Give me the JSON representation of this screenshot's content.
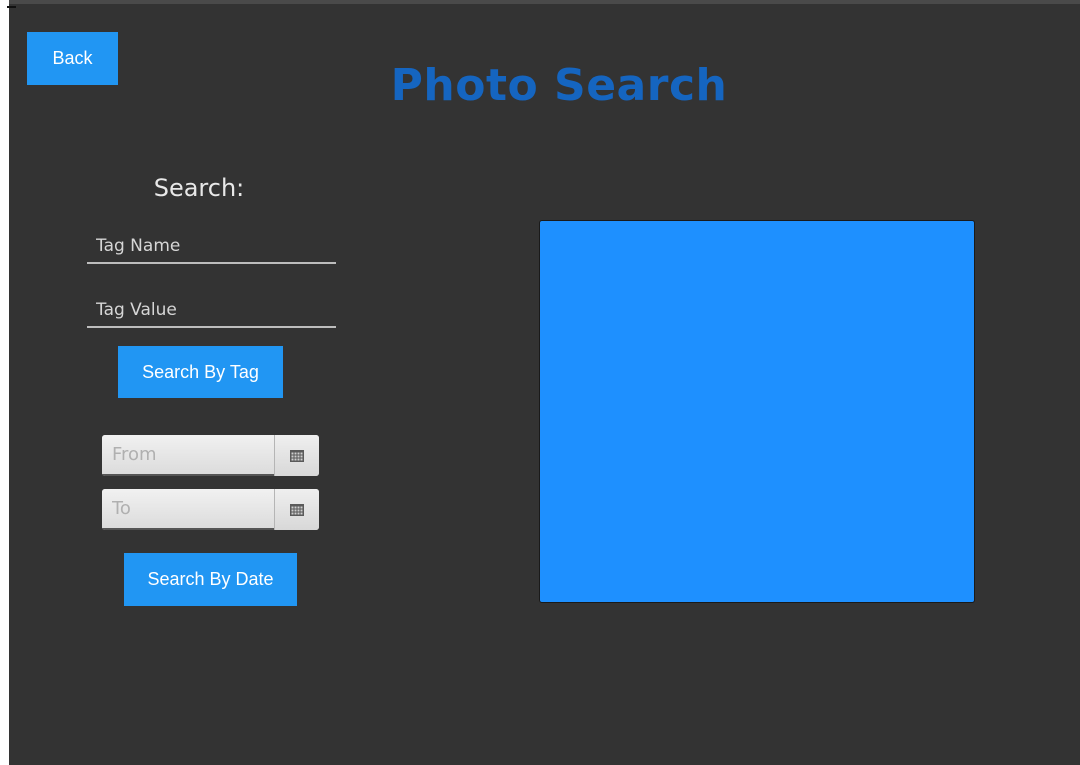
{
  "header": {
    "back_label": "Back",
    "title": "Photo Search"
  },
  "search_panel": {
    "label": "Search:",
    "tag_name": {
      "placeholder": "Tag Name",
      "value": ""
    },
    "tag_value": {
      "placeholder": "Tag Value",
      "value": ""
    },
    "search_by_tag_label": "Search By Tag",
    "from_date": {
      "placeholder": "From",
      "value": ""
    },
    "to_date": {
      "placeholder": "To",
      "value": ""
    },
    "search_by_date_label": "Search By Date"
  },
  "icons": {
    "calendar": "calendar-icon"
  },
  "colors": {
    "background": "#333333",
    "accent": "#2196f3",
    "title": "#1565c0",
    "photo_area": "#1e90ff"
  }
}
